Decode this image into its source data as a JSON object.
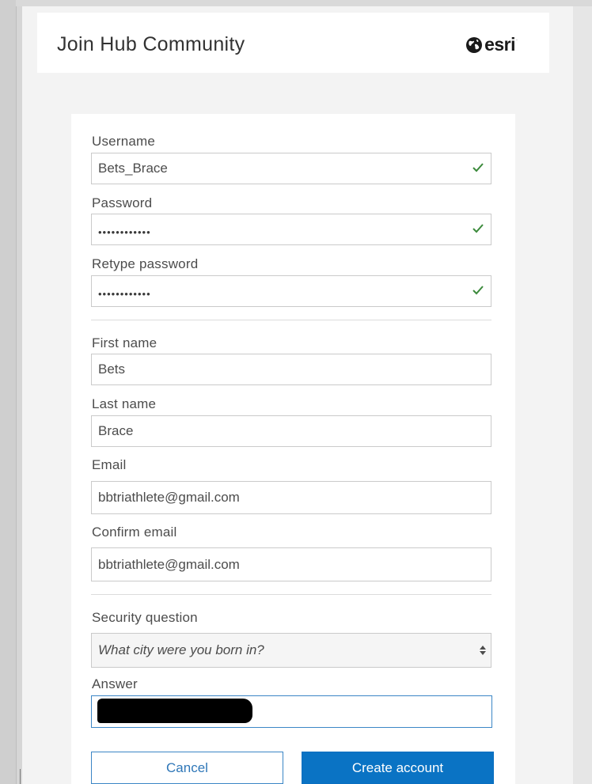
{
  "header": {
    "title": "Join Hub Community",
    "brand": "esri"
  },
  "form": {
    "username": {
      "label": "Username",
      "value": "Bets_Brace",
      "valid": true
    },
    "password": {
      "label": "Password",
      "value": "••••••••••••",
      "valid": true
    },
    "retype_password": {
      "label": "Retype password",
      "value": "••••••••••••",
      "valid": true
    },
    "first_name": {
      "label": "First name",
      "value": "Bets"
    },
    "last_name": {
      "label": "Last name",
      "value": "Brace"
    },
    "email": {
      "label": "Email",
      "value": "bbtriathlete@gmail.com"
    },
    "confirm_email": {
      "label": "Confirm email",
      "value": "bbtriathlete@gmail.com"
    },
    "security_question": {
      "label": "Security question",
      "value": "What city were you born in?"
    },
    "answer": {
      "label": "Answer",
      "value": ""
    }
  },
  "actions": {
    "cancel_label": "Cancel",
    "create_label": "Create account"
  },
  "colors": {
    "accent": "#0a73c4",
    "valid_check": "#3b8a3b",
    "page_bg": "#f3f3f3"
  },
  "icons": {
    "valid": "check-icon",
    "select": "select-arrows-icon",
    "brand": "globe-icon"
  }
}
